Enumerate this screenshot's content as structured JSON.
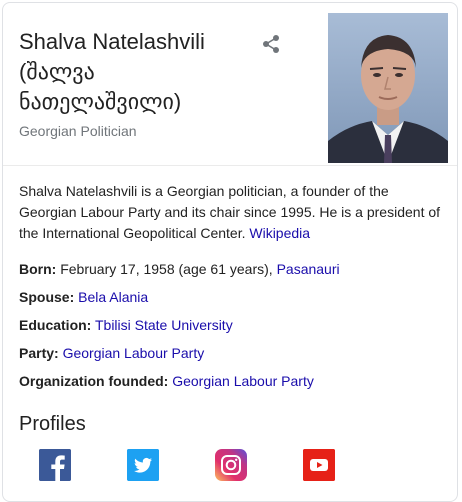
{
  "header": {
    "name": "Shalva Natelashvili",
    "native_line1": "(შალვა",
    "native_line2": "ნათელაშვილი)",
    "subtitle": "Georgian Politician",
    "share_icon": "share-icon"
  },
  "description": {
    "text": "Shalva Natelashvili is a Georgian politician, a founder of the Georgian Labour Party and its chair since 1995. He is a president of the International Geopolitical Center.",
    "source_link": "Wikipedia"
  },
  "facts": {
    "born": {
      "label": "Born:",
      "value": "February 17, 1958 (age 61 years),",
      "link": "Pasanauri"
    },
    "spouse": {
      "label": "Spouse:",
      "link": "Bela Alania"
    },
    "education": {
      "label": "Education:",
      "link": "Tbilisi State University"
    },
    "party": {
      "label": "Party:",
      "link": "Georgian Labour Party"
    },
    "organization": {
      "label": "Organization founded:",
      "link": "Georgian Labour Party"
    }
  },
  "profiles": {
    "title": "Profiles",
    "items": [
      {
        "icon": "facebook-icon",
        "color": "#3b5998"
      },
      {
        "icon": "twitter-icon",
        "color": "#1da1f2"
      },
      {
        "icon": "instagram-icon",
        "color": "#c13584"
      },
      {
        "icon": "youtube-icon",
        "color": "#e62117"
      }
    ]
  },
  "colors": {
    "link": "#1a0dab",
    "subtle_text": "#70757a",
    "border": "#dfe1e5"
  }
}
